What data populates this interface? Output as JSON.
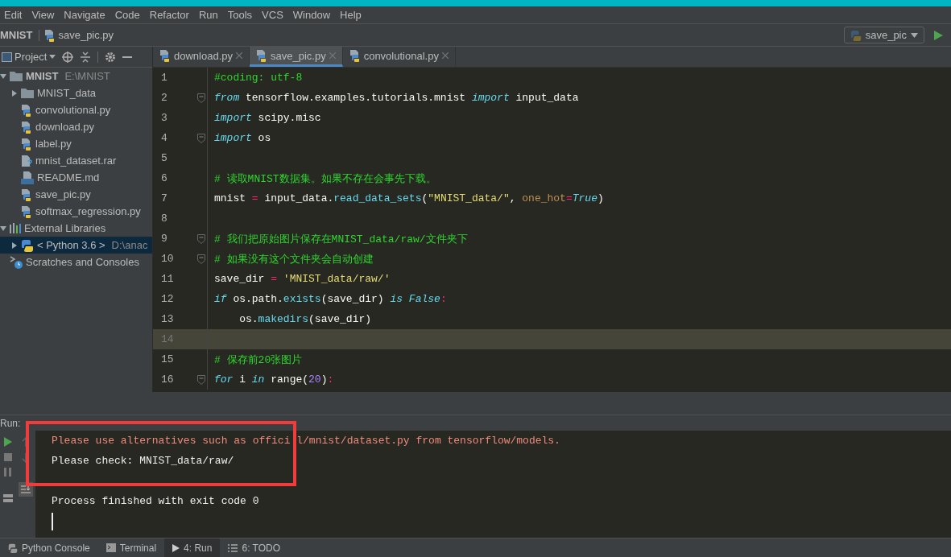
{
  "menu": [
    "Edit",
    "View",
    "Navigate",
    "Code",
    "Refactor",
    "Run",
    "Tools",
    "VCS",
    "Window",
    "Help"
  ],
  "breadcrumb": {
    "project": "MNIST",
    "file": "save_pic.py"
  },
  "run_config": {
    "label": "save_pic"
  },
  "project_panel": {
    "title": "Project",
    "tree": [
      {
        "label": "MNIST",
        "detail": "E:\\MNIST",
        "kind": "folder",
        "expanded": true,
        "selected": false,
        "children": [
          {
            "label": "MNIST_data",
            "kind": "folder",
            "expanded": false,
            "selected": false
          },
          {
            "label": "convolutional.py",
            "kind": "python",
            "selected": false
          },
          {
            "label": "download.py",
            "kind": "python",
            "selected": false
          },
          {
            "label": "label.py",
            "kind": "python",
            "selected": false
          },
          {
            "label": "mnist_dataset.rar",
            "kind": "unknown",
            "selected": false
          },
          {
            "label": "README.md",
            "kind": "markdown",
            "selected": false
          },
          {
            "label": "save_pic.py",
            "kind": "python",
            "selected": false
          },
          {
            "label": "softmax_regression.py",
            "kind": "python",
            "selected": false
          }
        ]
      },
      {
        "label": "External Libraries",
        "kind": "libraries",
        "expanded": true,
        "selected": false,
        "children": [
          {
            "label": "< Python 3.6 >",
            "detail": "D:\\anac",
            "kind": "sdk",
            "expanded": false,
            "selected": true
          }
        ]
      },
      {
        "label": "Scratches and Consoles",
        "kind": "scratches",
        "selected": false
      }
    ]
  },
  "tabs": [
    {
      "label": "download.py",
      "selected": false
    },
    {
      "label": "save_pic.py",
      "selected": true
    },
    {
      "label": "convolutional.py",
      "selected": false
    }
  ],
  "editor": {
    "lines": [
      {
        "number": "1",
        "fold": false,
        "current": false,
        "tokens": [
          {
            "kind": "comment",
            "text": "#coding: utf-8"
          }
        ]
      },
      {
        "number": "2",
        "fold": true,
        "current": false,
        "tokens": [
          {
            "kind": "keyword",
            "text": "from"
          },
          {
            "kind": "plain",
            "text": " tensorflow.examples.tutorials.mnist "
          },
          {
            "kind": "keyword",
            "text": "import"
          },
          {
            "kind": "plain",
            "text": " input_data"
          }
        ]
      },
      {
        "number": "3",
        "fold": false,
        "current": false,
        "tokens": [
          {
            "kind": "keyword",
            "text": "import"
          },
          {
            "kind": "plain",
            "text": " scipy.misc"
          }
        ]
      },
      {
        "number": "4",
        "fold": true,
        "current": false,
        "tokens": [
          {
            "kind": "keyword",
            "text": "import"
          },
          {
            "kind": "plain",
            "text": " os"
          }
        ]
      },
      {
        "number": "5",
        "fold": false,
        "current": false
      },
      {
        "number": "6",
        "fold": false,
        "current": false,
        "tokens": [
          {
            "kind": "comment",
            "text": "# 读取MNIST数据集。如果不存在会事先下载。"
          }
        ]
      },
      {
        "number": "7",
        "fold": false,
        "current": false,
        "tokens": [
          {
            "kind": "plain",
            "text": "mnist "
          },
          {
            "kind": "operator",
            "text": "="
          },
          {
            "kind": "plain",
            "text": " input_data."
          },
          {
            "kind": "function",
            "text": "read_data_sets"
          },
          {
            "kind": "plain",
            "text": "("
          },
          {
            "kind": "string",
            "text": "\"MNIST_data/\""
          },
          {
            "kind": "plain",
            "text": ", "
          },
          {
            "kind": "param",
            "text": "one_hot"
          },
          {
            "kind": "operator",
            "text": "="
          },
          {
            "kind": "keyword",
            "text": "True"
          },
          {
            "kind": "plain",
            "text": ")"
          }
        ]
      },
      {
        "number": "8",
        "fold": false,
        "current": false
      },
      {
        "number": "9",
        "fold": true,
        "current": false,
        "tokens": [
          {
            "kind": "comment",
            "text": "# 我们把原始图片保存在MNIST_data/raw/文件夹下"
          }
        ]
      },
      {
        "number": "10",
        "fold": true,
        "current": false,
        "tokens": [
          {
            "kind": "comment",
            "text": "# 如果没有这个文件夹会自动创建"
          }
        ]
      },
      {
        "number": "11",
        "fold": false,
        "current": false,
        "tokens": [
          {
            "kind": "plain",
            "text": "save_dir "
          },
          {
            "kind": "operator",
            "text": "="
          },
          {
            "kind": "string",
            "text": " 'MNIST_data/raw/'"
          }
        ]
      },
      {
        "number": "12",
        "fold": false,
        "current": false,
        "tokens": [
          {
            "kind": "keyword",
            "text": "if"
          },
          {
            "kind": "plain",
            "text": " os.path."
          },
          {
            "kind": "function",
            "text": "exists"
          },
          {
            "kind": "plain",
            "text": "(save_dir) "
          },
          {
            "kind": "keyword",
            "text": "is False"
          },
          {
            "kind": "operator",
            "text": ":"
          }
        ]
      },
      {
        "number": "13",
        "fold": false,
        "current": false,
        "tokens": [
          {
            "kind": "plain",
            "text": "    os."
          },
          {
            "kind": "function",
            "text": "makedirs"
          },
          {
            "kind": "plain",
            "text": "(save_dir)"
          }
        ]
      },
      {
        "number": "14",
        "fold": false,
        "current": true
      },
      {
        "number": "15",
        "fold": false,
        "current": false,
        "tokens": [
          {
            "kind": "comment",
            "text": "# 保存前20张图片"
          }
        ]
      },
      {
        "number": "16",
        "fold": true,
        "current": false,
        "tokens": [
          {
            "kind": "keyword",
            "text": "for"
          },
          {
            "kind": "plain",
            "text": " i "
          },
          {
            "kind": "keyword",
            "text": "in"
          },
          {
            "kind": "plain",
            "text": " range("
          },
          {
            "kind": "number",
            "text": "20"
          },
          {
            "kind": "plain",
            "text": ")"
          },
          {
            "kind": "operator",
            "text": ":"
          }
        ]
      }
    ]
  },
  "run_panel": {
    "label": "Run:",
    "output": [
      {
        "kind": "warning",
        "text": "Please use alternatives such as offici",
        "text_after": "l/mnist/dataset.py from tensorflow/models."
      },
      {
        "kind": "normal",
        "text": "Please check: MNIST_data/raw/"
      },
      {
        "kind": "blank"
      },
      {
        "kind": "normal",
        "text": "Process finished with exit code 0"
      }
    ]
  },
  "bottom_tabs": [
    {
      "label": "Python Console",
      "selected": false
    },
    {
      "label": "Terminal",
      "selected": false
    },
    {
      "label": "4: Run",
      "selected": true
    },
    {
      "label": "6: TODO",
      "selected": false
    }
  ]
}
